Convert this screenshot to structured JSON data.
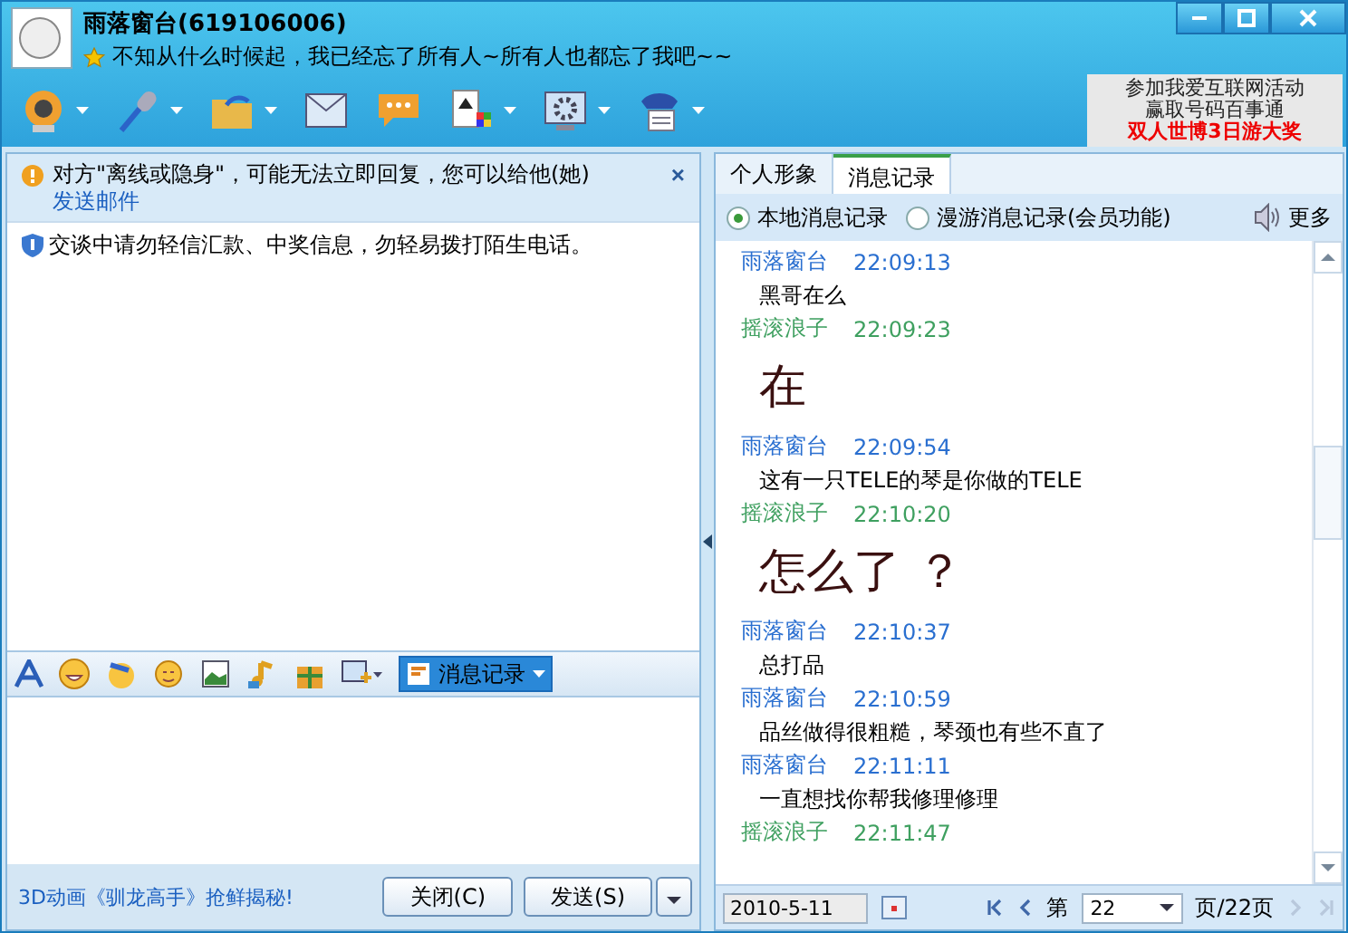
{
  "window": {
    "title": "雨落窗台(619106006)",
    "signature": "不知从什么时候起，我已经忘了所有人~所有人也都忘了我吧~~"
  },
  "ad": {
    "lines": [
      "参加我爱互联网活动",
      "赢取号码百事通"
    ],
    "highlight": "双人世博3日游大奖"
  },
  "notice": {
    "text": "对方\"离线或隐身\"，可能无法立即回复，您可以给他(她)",
    "link": "发送邮件",
    "close": "×"
  },
  "safety": "交谈中请勿轻信汇款、中奖信息，勿轻易拨打陌生电话。",
  "input_toolbar": {
    "history_button": "消息记录"
  },
  "footer": {
    "promo": "3D动画《驯龙高手》抢鲜揭秘!",
    "close_button": "关闭(C)",
    "send_button": "发送(S)"
  },
  "tabs": [
    {
      "label": "个人形象",
      "selected": false
    },
    {
      "label": "消息记录",
      "selected": true
    }
  ],
  "history_source": [
    {
      "label": "本地消息记录",
      "selected": true
    },
    {
      "label": "漫游消息记录(会员功能)",
      "selected": false
    }
  ],
  "more": "更多",
  "messages": [
    {
      "sender": "雨落窗台",
      "time": "22:09:13",
      "color": "#2a6fd0",
      "kind": "normal",
      "text": "黑哥在么"
    },
    {
      "sender": "摇滚浪子",
      "time": "22:09:23",
      "color": "#3fa060",
      "kind": "large",
      "text": "在"
    },
    {
      "sender": "雨落窗台",
      "time": "22:09:54",
      "color": "#2a6fd0",
      "kind": "normal",
      "text": "这有一只TELE的琴是你做的TELE"
    },
    {
      "sender": "摇滚浪子",
      "time": "22:10:20",
      "color": "#3fa060",
      "kind": "large",
      "text": "怎么了 ？"
    },
    {
      "sender": "雨落窗台",
      "time": "22:10:37",
      "color": "#2a6fd0",
      "kind": "normal",
      "text": "总打品"
    },
    {
      "sender": "雨落窗台",
      "time": "22:10:59",
      "color": "#2a6fd0",
      "kind": "normal",
      "text": "品丝做得很粗糙，琴颈也有些不直了"
    },
    {
      "sender": "雨落窗台",
      "time": "22:11:11",
      "color": "#2a6fd0",
      "kind": "normal",
      "text": "一直想找你帮我修理修理"
    },
    {
      "sender": "摇滚浪子",
      "time": "22:11:47",
      "color": "#3fa060"
    }
  ],
  "pager": {
    "date": "2010-5-11",
    "prefix": "第",
    "page": "22",
    "suffix": "页/22页"
  }
}
